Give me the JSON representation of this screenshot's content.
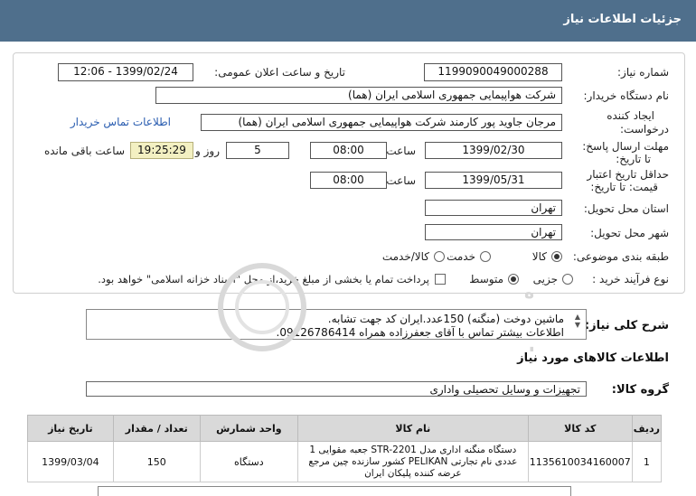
{
  "header": {
    "title": "جزئیات اطلاعات نیاز"
  },
  "need_number": {
    "label": "شماره نیاز:",
    "value": "1199090049000288"
  },
  "announce": {
    "label": "تاریخ و ساعت اعلان عمومی:",
    "value": "1399/02/24 - 12:06"
  },
  "buyer": {
    "label": "نام دستگاه خریدار:",
    "value": "شرکت هواپیمایی جمهوری اسلامی ایران (هما)"
  },
  "creator": {
    "label_line1": "ایجاد کننده",
    "label_line2": "درخواست:",
    "value": "مرجان جاوید پور کارمند شرکت هواپیمایی جمهوری اسلامی ایران (هما)",
    "contact_link": "اطلاعات تماس خریدار"
  },
  "deadline": {
    "label_line1": "مهلت ارسال پاسخ:",
    "label_line2": "تا تاریخ:",
    "date": "1399/02/30",
    "time_label": "ساعت",
    "time": "08:00",
    "days": "5",
    "days_label": "روز و",
    "remaining": "19:25:29",
    "remaining_label": "ساعت باقی مانده"
  },
  "validity": {
    "label_line1": "حداقل تاریخ اعتبار",
    "label_line2": "قیمت: تا تاریخ:",
    "date": "1399/05/31",
    "time_label": "ساعت",
    "time": "08:00"
  },
  "province": {
    "label": "استان محل تحویل:",
    "value": "تهران"
  },
  "city": {
    "label": "شهر محل تحویل:",
    "value": "تهران"
  },
  "category": {
    "label": "طبقه بندی موضوعی:",
    "options": [
      "کالا",
      "خدمت",
      "کالا/خدمت"
    ],
    "selected": 0
  },
  "process": {
    "label": "نوع فرآیند خرید :",
    "options": [
      "جزیی",
      "متوسط"
    ],
    "selected": 1,
    "checkbox_label": "پرداخت تمام یا بخشی از مبلغ خرید،از محل \"اسناد خزانه اسلامی\" خواهد بود."
  },
  "description": {
    "label": "شرح کلی نیاز:",
    "line1": "ماشین دوخت (منگنه) 150عدد.ایران کد جهت تشابه.",
    "line2": "اطلاعات بیشتر تماس با آقای جعفرزاده همراه 09126786414."
  },
  "goods_info": {
    "title": "اطلاعات کالاهای مورد نیاز"
  },
  "goods_group": {
    "label": "گروه کالا:",
    "value": "تجهیزات و وسایل تحصیلی واداری"
  },
  "table": {
    "headers": [
      "ردیف",
      "کد کالا",
      "نام کالا",
      "واحد شمارش",
      "تعداد / مقدار",
      "تاریخ نیاز"
    ],
    "rows": [
      {
        "row": "1",
        "code": "1135610034160007",
        "name": "دستگاه منگنه اداری مدل STR-2201 جعبه مقوایی 1 عددی نام تجارتی PELIKAN کشور سازنده چین مرجع عرضه کننده پلیکان ایران",
        "unit": "دستگاه",
        "qty": "150",
        "date": "1399/03/04"
      }
    ]
  },
  "watermark": {
    "text_line1": "پایگاه اطلاع رسانی مناقصه و مزایده",
    "text_line2": "۰۲۱-۸۸۳۴۹۶۷۰-۵"
  },
  "colors": {
    "header_bg": "#4f6f8c",
    "link": "#2a5db0",
    "remaining_bg": "#f3f0c2"
  }
}
